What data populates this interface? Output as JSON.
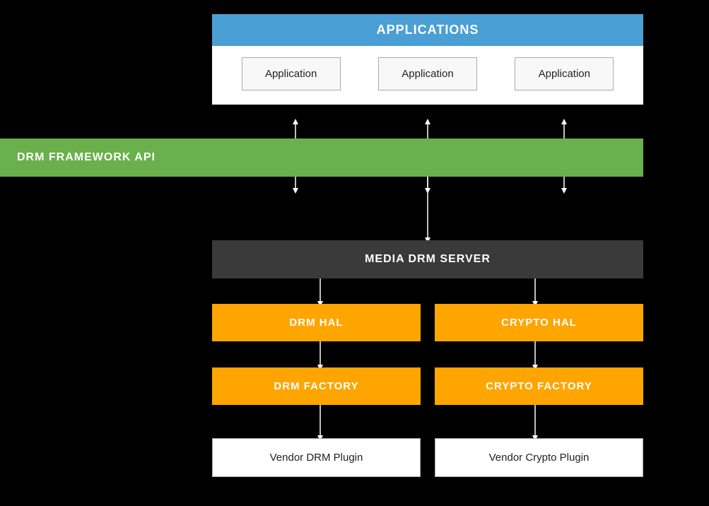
{
  "applications": {
    "header": "APPLICATIONS",
    "apps": [
      {
        "label": "Application"
      },
      {
        "label": "Application"
      },
      {
        "label": "Application"
      }
    ]
  },
  "drm_framework": {
    "label": "DRM FRAMEWORK API"
  },
  "media_drm_server": {
    "label": "MEDIA DRM SERVER"
  },
  "hal_row": {
    "left": "DRM HAL",
    "right": "CRYPTO HAL"
  },
  "factory_row": {
    "left": "DRM FACTORY",
    "right": "CRYPTO FACTORY"
  },
  "vendor_row": {
    "left": "Vendor DRM Plugin",
    "right": "Vendor Crypto Plugin"
  },
  "colors": {
    "blue": "#4A9FD4",
    "green": "#6AB04C",
    "dark_gray": "#3a3a3a",
    "orange": "#FFA500",
    "white": "#ffffff",
    "black": "#000000"
  }
}
